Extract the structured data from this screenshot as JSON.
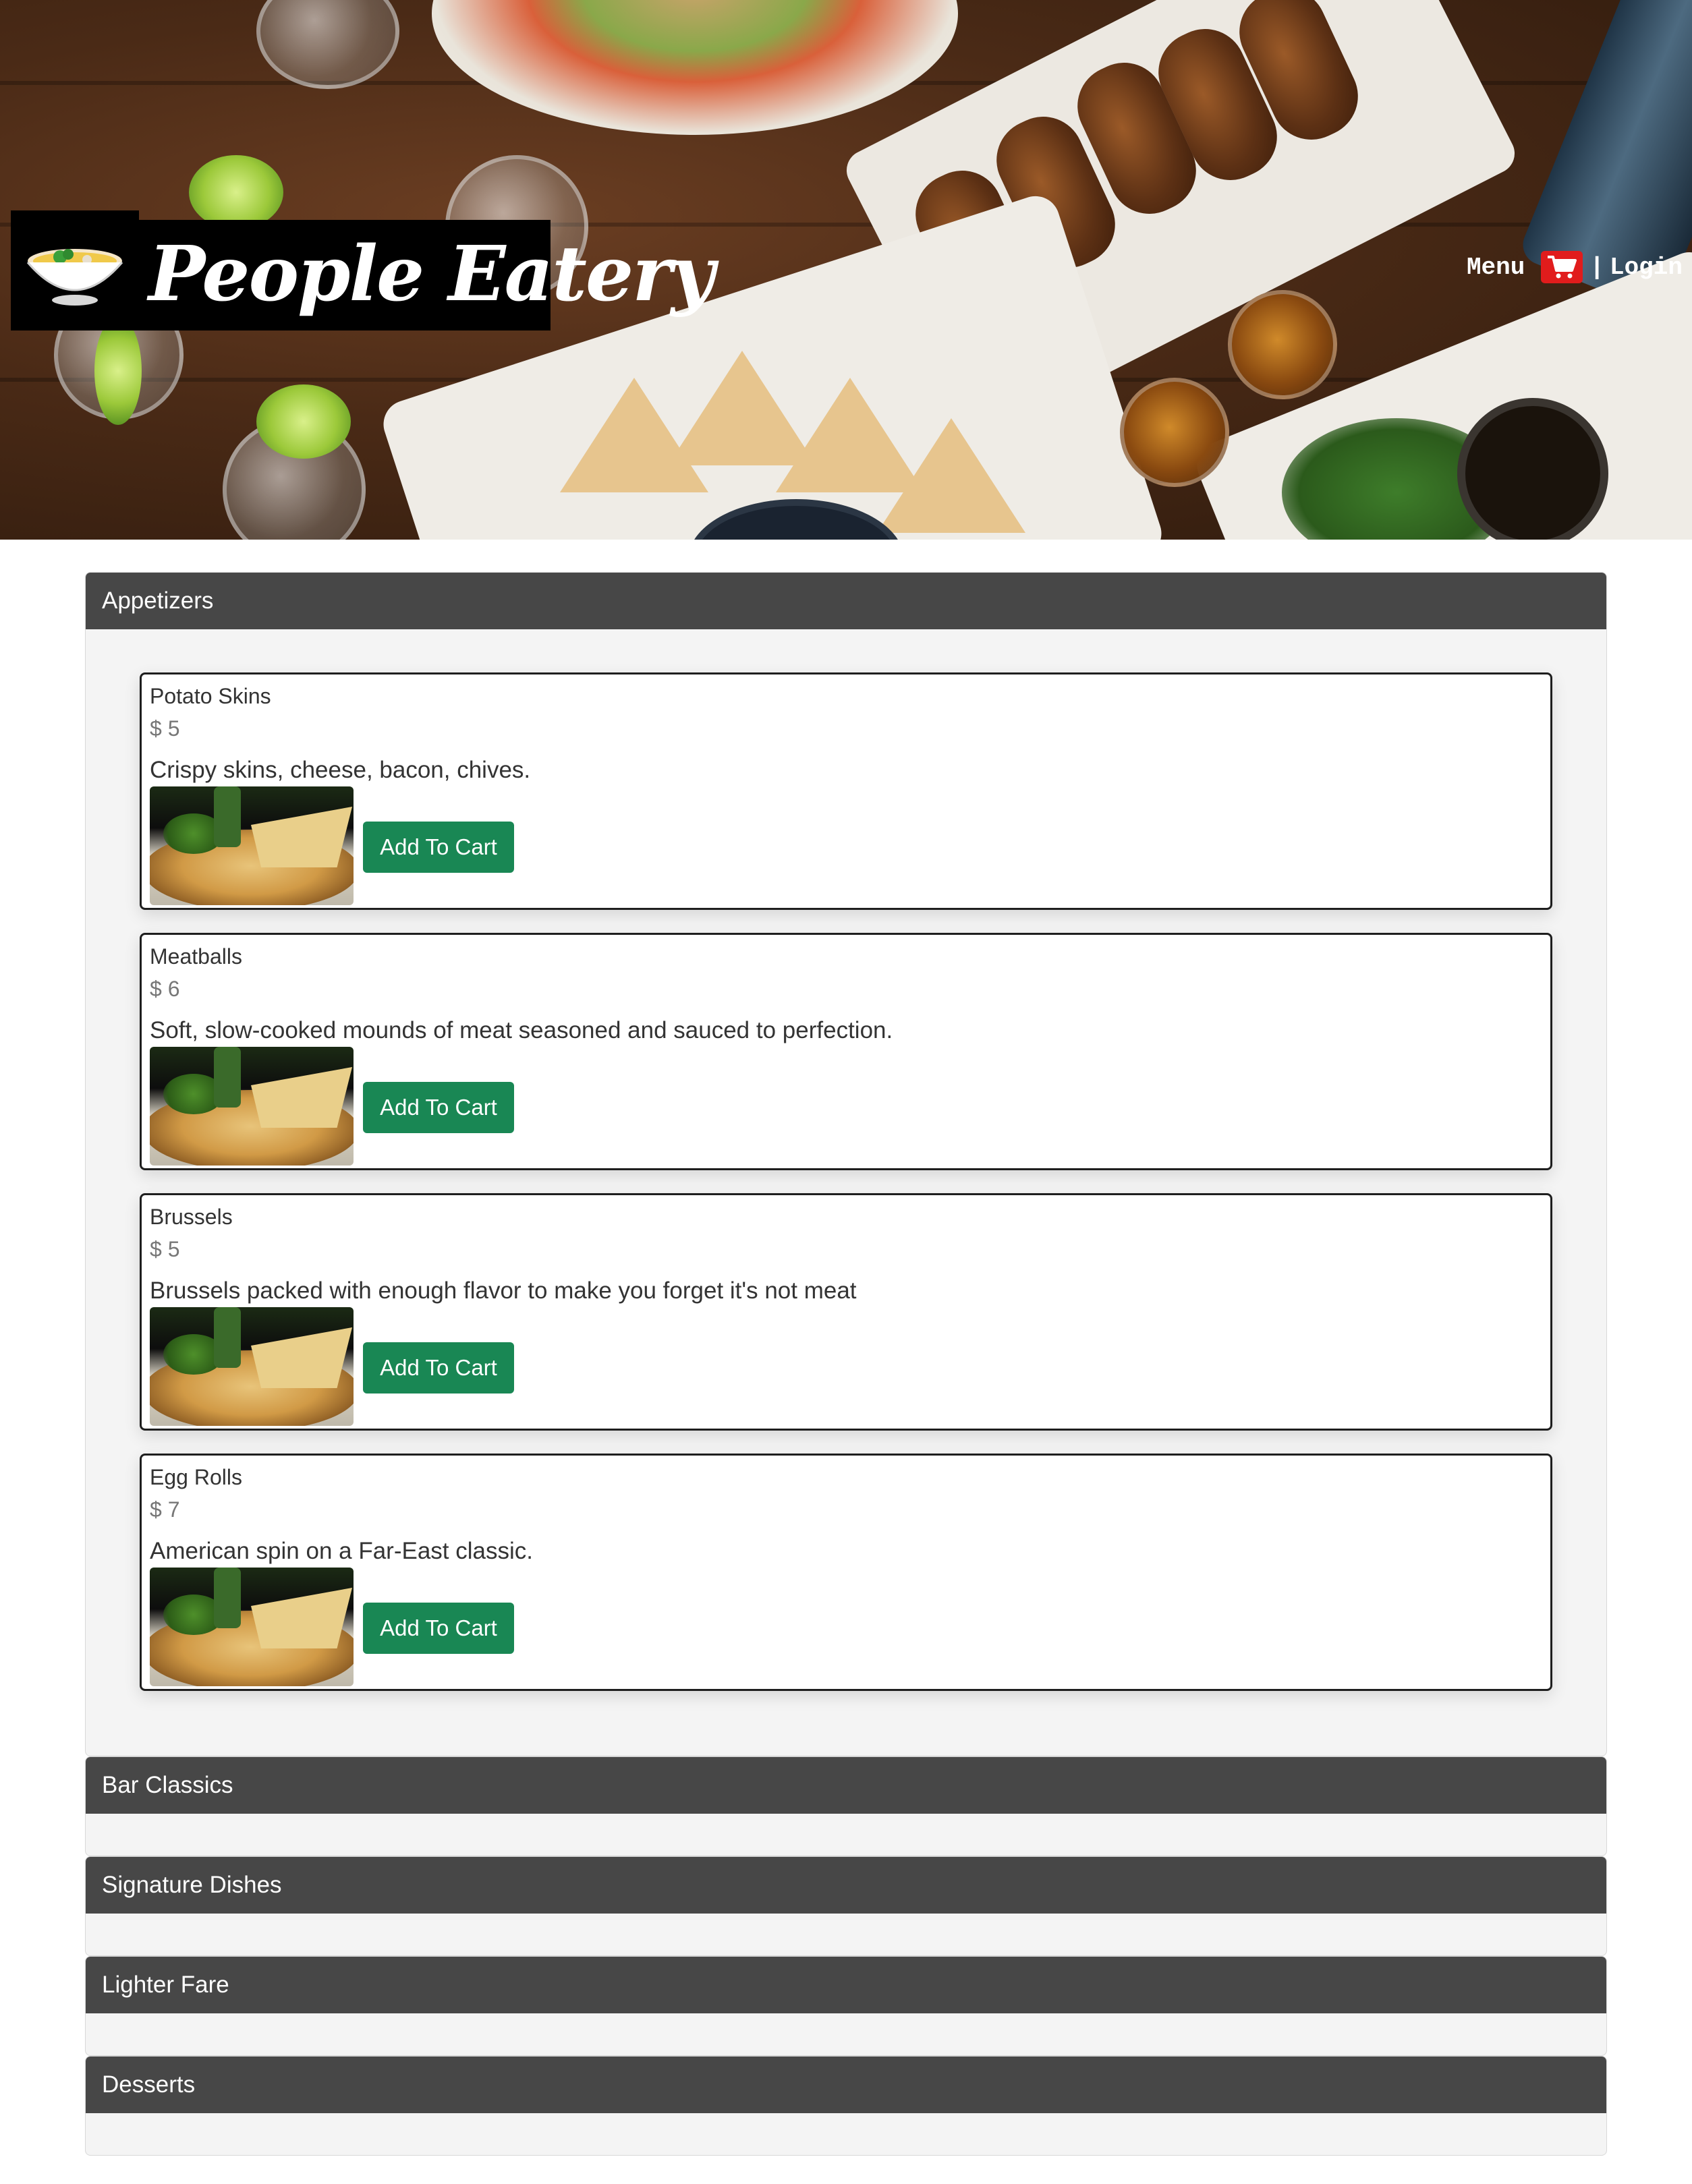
{
  "header": {
    "brand_title": "People Eatery",
    "logo_icon": "soup-bowl-icon",
    "nav": {
      "menu_label": "Menu",
      "cart_icon": "shopping-cart-icon",
      "separator": "|",
      "login_label": "Login"
    }
  },
  "colors": {
    "section_header": "#474747",
    "button": "#198754",
    "cart": "#e11c1c"
  },
  "sections": [
    {
      "title": "Appetizers",
      "items": [
        {
          "name": "Potato Skins",
          "price": "$ 5",
          "description": "Crispy skins, cheese, bacon, chives.",
          "button": "Add To Cart"
        },
        {
          "name": "Meatballs",
          "price": "$ 6",
          "description": "Soft, slow-cooked mounds of meat seasoned and sauced to perfection.",
          "button": "Add To Cart"
        },
        {
          "name": "Brussels",
          "price": "$ 5",
          "description": "Brussels packed with enough flavor to make you forget it's not meat",
          "button": "Add To Cart"
        },
        {
          "name": "Egg Rolls",
          "price": "$ 7",
          "description": "American spin on a Far-East classic.",
          "button": "Add To Cart"
        }
      ]
    },
    {
      "title": "Bar Classics"
    },
    {
      "title": "Signature Dishes"
    },
    {
      "title": "Lighter Fare"
    },
    {
      "title": "Desserts"
    }
  ]
}
